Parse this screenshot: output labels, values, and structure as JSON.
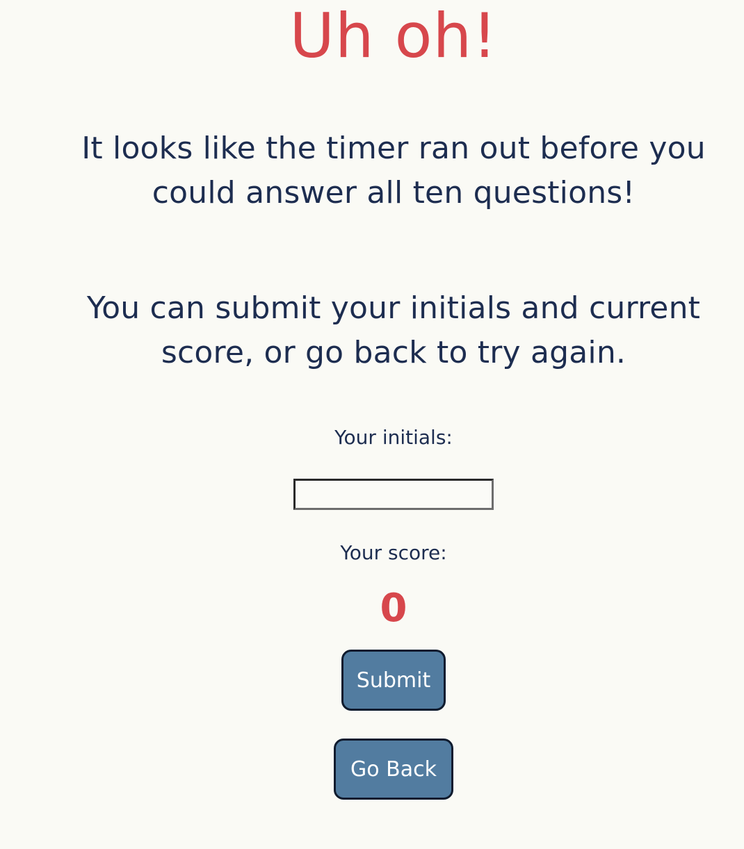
{
  "header": {
    "title": "Uh oh!"
  },
  "messages": {
    "timeout": "It looks like the timer ran out before you could answer all ten questions!",
    "options": "You can submit your initials and current score, or go back to try again."
  },
  "form": {
    "initials_label": "Your initials:",
    "initials_value": "",
    "score_label": "Your score:",
    "score_value": "0"
  },
  "actions": {
    "submit_label": "Submit",
    "go_back_label": "Go Back"
  },
  "colors": {
    "accent_red": "#d7474c",
    "text_navy": "#1d2d50",
    "button_blue": "#527ca0",
    "background": "#fafaf5"
  }
}
